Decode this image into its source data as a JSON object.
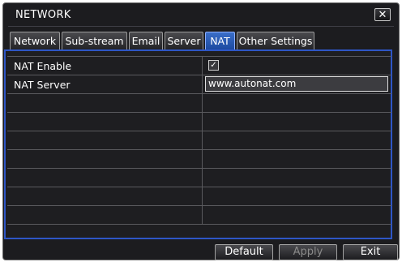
{
  "window": {
    "title": "NETWORK",
    "close_glyph": "✕",
    "close_icon": "close-icon"
  },
  "tabs": [
    {
      "label": "Network",
      "active": false
    },
    {
      "label": "Sub-stream",
      "active": false
    },
    {
      "label": "Email",
      "active": false
    },
    {
      "label": "Server",
      "active": false
    },
    {
      "label": "NAT",
      "active": true
    },
    {
      "label": "Other Settings",
      "active": false
    }
  ],
  "nat": {
    "enable_label": "NAT Enable",
    "enable_checked": true,
    "enable_check_glyph": "✓",
    "server_label": "NAT Server",
    "server_value": "www.autonat.com"
  },
  "buttons": {
    "default_label": "Default",
    "apply_label": "Apply",
    "apply_enabled": false,
    "exit_label": "Exit"
  },
  "colors": {
    "accent": "#2e56c6",
    "active_tab": "#2f62c0",
    "background": "#1c1c1f"
  }
}
